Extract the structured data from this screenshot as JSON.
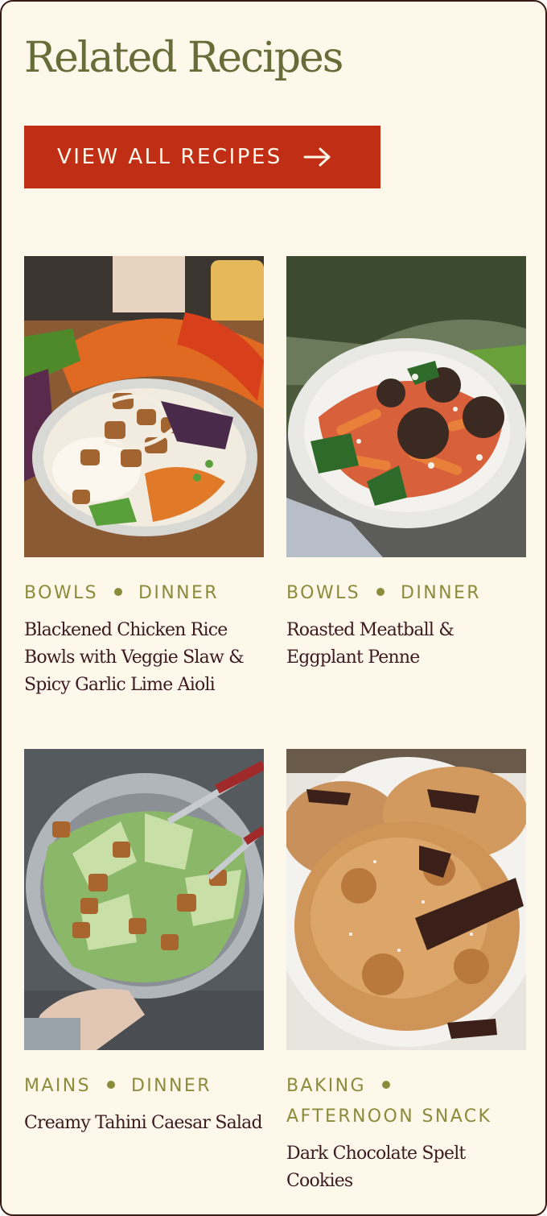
{
  "section": {
    "title": "Related Recipes",
    "cta_label": "VIEW ALL RECIPES",
    "cta_icon": "arrow-right-icon"
  },
  "colors": {
    "background": "#fdf8ea",
    "title": "#676c38",
    "cta": "#c02e16",
    "tag": "#8a8c3c",
    "recipe_text": "#3b1a20"
  },
  "recipes": [
    {
      "tags": [
        "BOWLS",
        "DINNER"
      ],
      "name": "Blackened Chicken Rice Bowls with Veggie Slaw & Spicy Garlic Lime Aioli",
      "image": "chicken-rice-bowl-photo"
    },
    {
      "tags": [
        "BOWLS",
        "DINNER"
      ],
      "name": "Roasted Meatball & Eggplant Penne",
      "image": "meatball-penne-photo"
    },
    {
      "tags": [
        "MAINS",
        "DINNER"
      ],
      "name": "Creamy Tahini Caesar Salad",
      "image": "caesar-salad-photo"
    },
    {
      "tags": [
        "BAKING",
        "AFTERNOON SNACK"
      ],
      "name": "Dark Chocolate Spelt Cookies",
      "image": "chocolate-cookies-photo"
    }
  ]
}
